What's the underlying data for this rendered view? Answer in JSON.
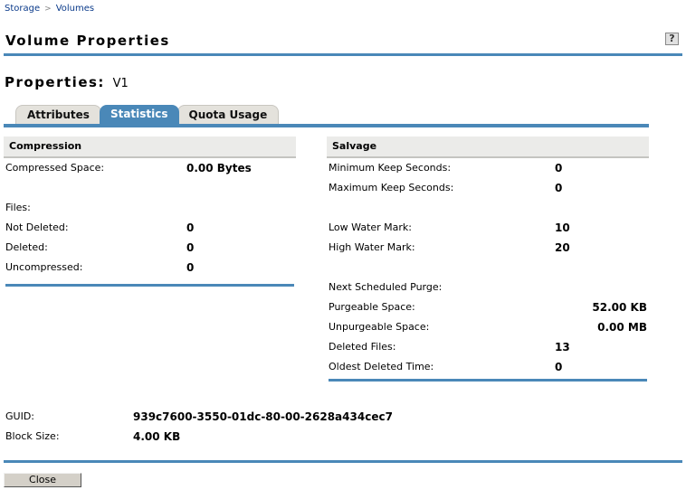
{
  "breadcrumb": {
    "items": [
      "Storage",
      "Volumes"
    ],
    "separator": ">"
  },
  "header": {
    "title": "Volume Properties",
    "help_label": "?"
  },
  "properties": {
    "label": "Properties:",
    "name": "V1"
  },
  "tabs": [
    {
      "label": "Attributes",
      "active": false
    },
    {
      "label": "Statistics",
      "active": true
    },
    {
      "label": "Quota Usage",
      "active": false
    }
  ],
  "compression": {
    "title": "Compression",
    "compressed_space": {
      "label": "Compressed Space:",
      "value": "0.00 Bytes"
    },
    "files_label": "Files:",
    "not_deleted": {
      "label": "Not Deleted:",
      "value": "0"
    },
    "deleted": {
      "label": "Deleted:",
      "value": "0"
    },
    "uncompressed": {
      "label": "Uncompressed:",
      "value": "0"
    }
  },
  "salvage": {
    "title": "Salvage",
    "min_keep": {
      "label": "Minimum Keep Seconds:",
      "value": "0"
    },
    "max_keep": {
      "label": "Maximum Keep Seconds:",
      "value": "0"
    },
    "low_water": {
      "label": "Low Water Mark:",
      "value": "10"
    },
    "high_water": {
      "label": "High Water Mark:",
      "value": "20"
    },
    "next_purge_label": "Next Scheduled Purge:",
    "purgeable": {
      "label": "Purgeable Space:",
      "value": "52.00 KB"
    },
    "unpurgeable": {
      "label": "Unpurgeable Space:",
      "value": "0.00 MB"
    },
    "deleted_files": {
      "label": "Deleted Files:",
      "value": "13"
    },
    "oldest_deleted": {
      "label": "Oldest Deleted Time:",
      "value": "0"
    }
  },
  "general": {
    "guid": {
      "label": "GUID:",
      "value": "939c7600-3550-01dc-80-00-2628a434cec7"
    },
    "block_size": {
      "label": "Block Size:",
      "value": "4.00 KB"
    }
  },
  "footer": {
    "close_label": "Close"
  }
}
